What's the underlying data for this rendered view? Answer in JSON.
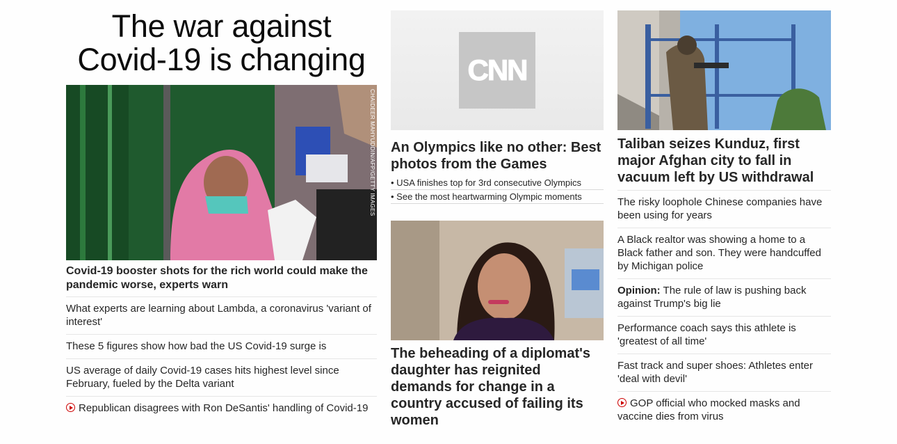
{
  "col1": {
    "headline": "The war against Covid-19 is changing",
    "image_credit": "CHAIDEER MAHYUDDIN/AFP/GETTY IMAGES",
    "lead": "Covid-19 booster shots for the rich world could make the pandemic worse, experts warn",
    "links": [
      {
        "text": "What experts are learning about Lambda, a coronavirus 'variant of interest'"
      },
      {
        "text": "These 5 figures show how bad the US Covid-19 surge is"
      },
      {
        "text": "US average of daily Covid-19 cases hits highest level since February, fueled by the Delta variant"
      },
      {
        "text": "Republican disagrees with Ron DeSantis' handling of Covid-19",
        "video": true
      }
    ]
  },
  "col2": {
    "logo_text": "CNN",
    "lead1": "An Olympics like no other: Best photos from the Games",
    "bullets": [
      "• USA finishes top for 3rd consecutive Olympics",
      "• See the most heartwarming Olympic moments"
    ],
    "lead2": "The beheading of a diplomat's daughter has reignited demands for change in a country accused of failing its women"
  },
  "col3": {
    "lead": "Taliban seizes Kunduz, first major Afghan city to fall in vacuum left by US withdrawal",
    "links": [
      {
        "text": "The risky loophole Chinese companies have been using for years"
      },
      {
        "text": "A Black realtor was showing a home to a Black father and son. They were handcuffed by Michigan police"
      },
      {
        "prefix": "Opinion:",
        "text": " The rule of law is pushing back against Trump's big lie"
      },
      {
        "text": "Performance coach says this athlete is 'greatest of all time'"
      },
      {
        "text": "Fast track and super shoes: Athletes enter 'deal with devil'"
      },
      {
        "text": "GOP official who mocked masks and vaccine dies from virus",
        "video": true
      }
    ]
  },
  "colors": {
    "text": "#262626",
    "divider": "#e6e6e6",
    "video_red": "#cc0000",
    "logo_gray": "#c6c6c6"
  }
}
